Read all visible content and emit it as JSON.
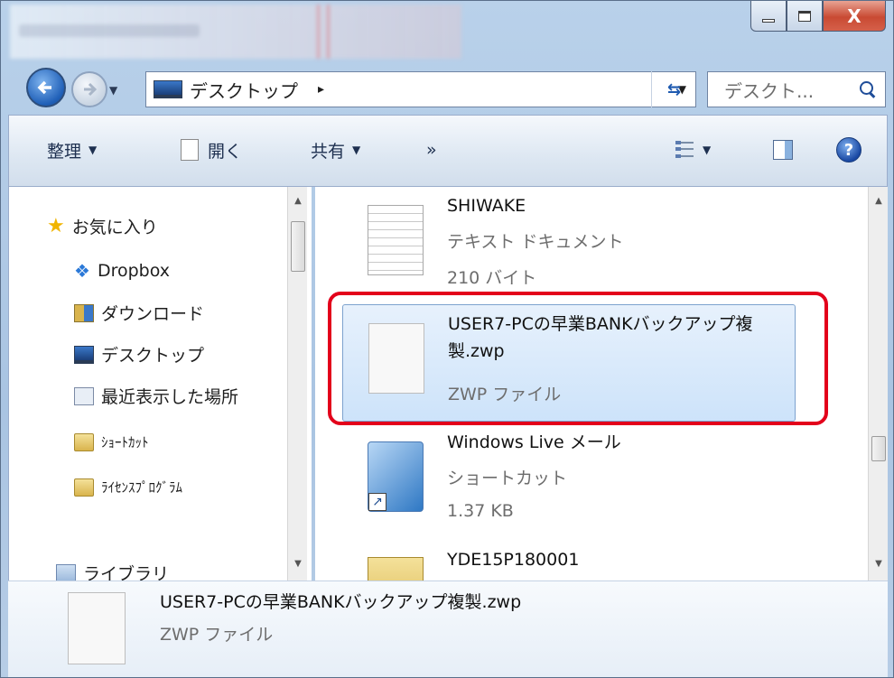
{
  "window": {
    "caption_close": "X"
  },
  "address_bar": {
    "location": "デスクトップ",
    "separator": "▸"
  },
  "search": {
    "placeholder": "デスクト..."
  },
  "command_bar": {
    "organize": "整理",
    "open": "開く",
    "share": "共有",
    "more": "»"
  },
  "nav_pane": {
    "favorites": "お気に入り",
    "items": [
      {
        "label": "Dropbox",
        "icon": "dropbox-icon"
      },
      {
        "label": "ダウンロード",
        "icon": "downloads-folder-icon"
      },
      {
        "label": "デスクトップ",
        "icon": "desktop-icon"
      },
      {
        "label": "最近表示した場所",
        "icon": "recent-places-icon"
      },
      {
        "label": "ｼｮｰﾄｶｯﾄ",
        "icon": "folder-icon"
      },
      {
        "label": "ﾗｲｾﾝｽﾌﾟﾛｸﾞﾗﾑ",
        "icon": "folder-icon"
      }
    ],
    "library": "ライブラリ"
  },
  "files": [
    {
      "name": "SHIWAKE",
      "type": "テキスト ドキュメント",
      "size": "210 バイト",
      "icon": "text-document-icon"
    },
    {
      "name": "USER7-PCの早業BANKバックアップ複製.zwp",
      "type": "ZWP ファイル",
      "icon": "blank-file-icon",
      "selected": true
    },
    {
      "name": "Windows Live メール",
      "type": "ショートカット",
      "size": "1.37 KB",
      "icon": "windows-live-mail-icon"
    },
    {
      "name": "YDE15P180001",
      "icon": "folder-icon"
    }
  ],
  "details_pane": {
    "name": "USER7-PCの早業BANKバックアップ複製.zwp",
    "type": "ZWP ファイル"
  },
  "colors": {
    "highlight_ring": "#e3001b",
    "selection_fill": "#cde3fa"
  }
}
